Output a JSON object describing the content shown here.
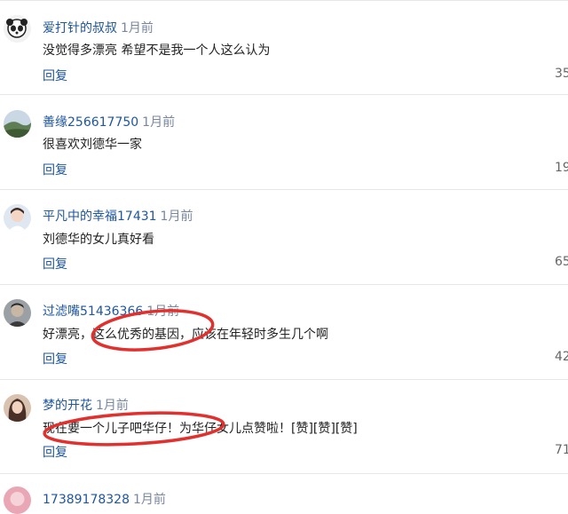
{
  "comments": [
    {
      "user": "爱打针的叔叔",
      "time": "1月前",
      "text": "没觉得多漂亮 希望不是我一个人这么认为",
      "reply": "回复",
      "likes": "35",
      "avatar_icon": "panda-avatar-icon"
    },
    {
      "user": "善缘256617750",
      "time": "1月前",
      "text": "很喜欢刘德华一家",
      "reply": "回复",
      "likes": "19",
      "avatar_icon": "landscape-avatar-icon"
    },
    {
      "user": "平凡中的幸福17431",
      "time": "1月前",
      "text": "刘德华的女儿真好看",
      "reply": "回复",
      "likes": "65",
      "avatar_icon": "girl-avatar-icon"
    },
    {
      "user": "过滤嘴51436366",
      "time": "1月前",
      "text": "好漂亮，这么优秀的基因，应该在年轻时多生几个啊",
      "reply": "回复",
      "likes": "42",
      "avatar_icon": "man-avatar-icon"
    },
    {
      "user": "梦的开花",
      "time": "1月前",
      "text": "现在要一个儿子吧华仔！为华仔女儿点赞啦！[赞][赞][赞]",
      "reply": "回复",
      "likes": "71",
      "avatar_icon": "woman-avatar-icon"
    },
    {
      "user": "17389178328",
      "time": "1月前",
      "text": "",
      "reply": "",
      "likes": "",
      "avatar_icon": "pink-avatar-icon"
    }
  ],
  "colors": {
    "username": "#1e56a0",
    "annotation": "#e0312f"
  }
}
